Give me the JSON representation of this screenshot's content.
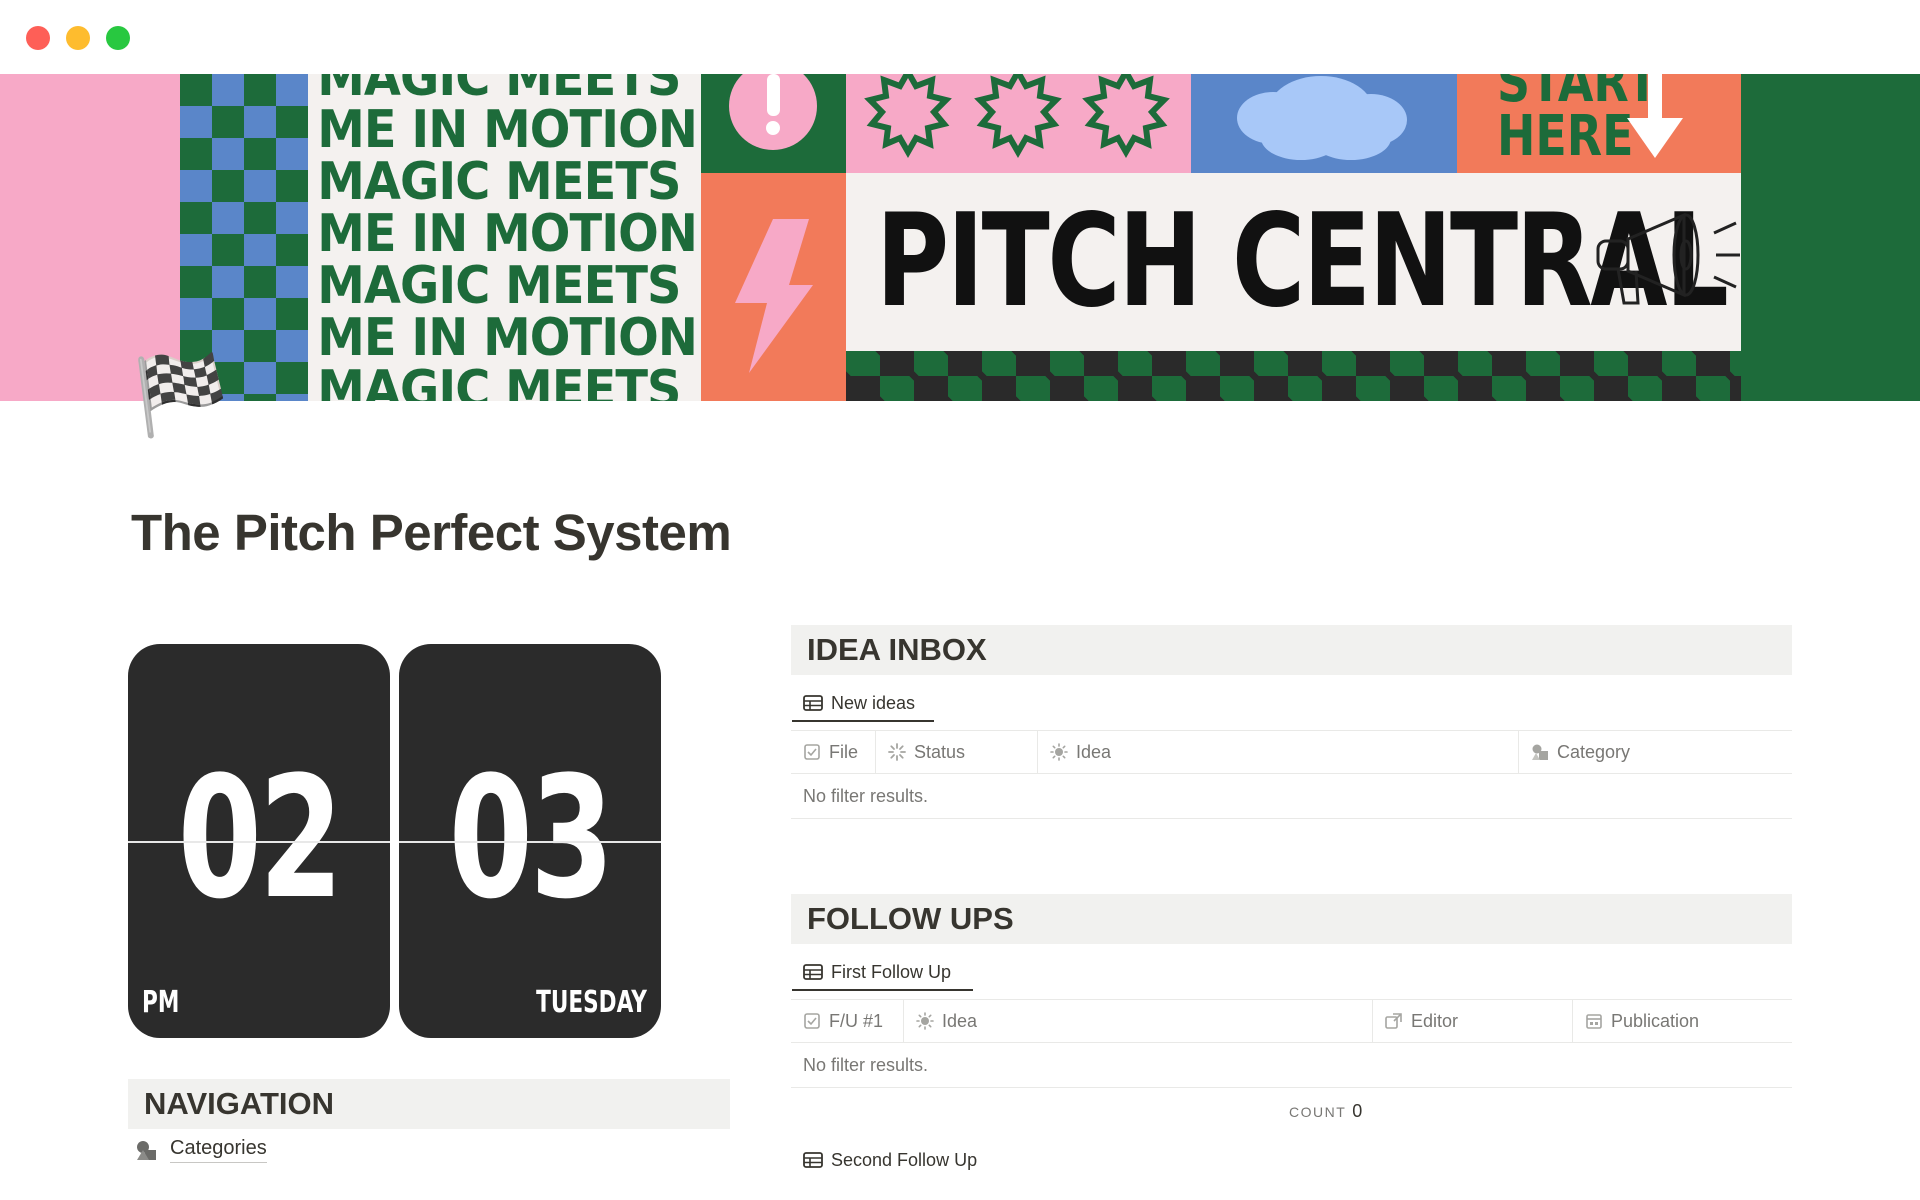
{
  "window": {
    "controls": [
      "close",
      "minimize",
      "zoom"
    ]
  },
  "cover": {
    "motion_lines": [
      "MAGIC MEETS",
      "ME IN MOTION",
      "MAGIC MEETS",
      "ME IN MOTION",
      "MAGIC MEETS",
      "ME IN MOTION",
      "MAGIC MEETS"
    ],
    "start_here": "START HERE",
    "banner_title": "PITCH CENTRAL",
    "colors": {
      "pink": "#f7a9c7",
      "green": "#1d6b3a",
      "blue": "#5a86c9",
      "orange": "#f27a5a",
      "cream": "#f4f1ef"
    }
  },
  "page": {
    "icon": "🏁",
    "title": "The Pitch Perfect System"
  },
  "clock": {
    "hour": "02",
    "minute": "03",
    "period": "PM",
    "day": "TUESDAY"
  },
  "navigation": {
    "header": "NAVIGATION",
    "items": [
      {
        "label": "Categories",
        "icon": "shapes-icon"
      }
    ]
  },
  "idea_inbox": {
    "header": "IDEA INBOX",
    "view": {
      "label": "New ideas",
      "icon": "table-icon"
    },
    "columns": [
      {
        "label": "File",
        "icon": "checkbox-icon"
      },
      {
        "label": "Status",
        "icon": "status-icon"
      },
      {
        "label": "Idea",
        "icon": "sun-icon"
      },
      {
        "label": "Category",
        "icon": "shapes-icon"
      }
    ],
    "empty_text": "No filter results."
  },
  "follow_ups": {
    "header": "FOLLOW UPS",
    "views": [
      {
        "label": "First Follow Up",
        "icon": "table-icon",
        "columns": [
          {
            "label": "F/U #1",
            "icon": "checkbox-icon"
          },
          {
            "label": "Idea",
            "icon": "sun-icon"
          },
          {
            "label": "Editor",
            "icon": "relation-icon"
          },
          {
            "label": "Publication",
            "icon": "calendar-icon"
          }
        ],
        "empty_text": "No filter results.",
        "count_label": "COUNT",
        "count_value": "0"
      },
      {
        "label": "Second Follow Up",
        "icon": "table-icon"
      }
    ]
  }
}
